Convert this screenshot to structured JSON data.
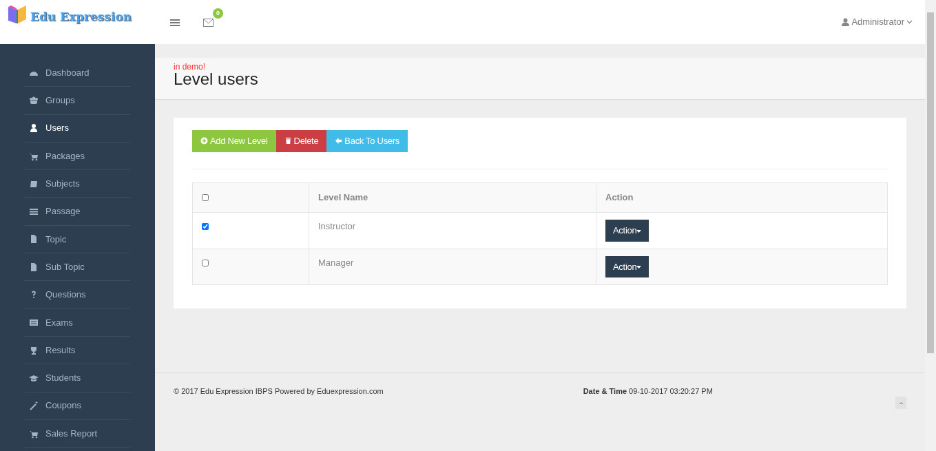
{
  "header": {
    "logo": "Edu Expression",
    "notifications": "0",
    "user": "Administrator"
  },
  "sidebar": {
    "items": [
      {
        "label": "Dashboard",
        "selected": false
      },
      {
        "label": "Groups",
        "selected": false
      },
      {
        "label": "Users",
        "selected": true
      },
      {
        "label": "Packages",
        "selected": false
      },
      {
        "label": "Subjects",
        "selected": false
      },
      {
        "label": "Passage",
        "selected": false
      },
      {
        "label": "Topic",
        "selected": false
      },
      {
        "label": "Sub Topic",
        "selected": false
      },
      {
        "label": "Questions",
        "selected": false
      },
      {
        "label": "Exams",
        "selected": false
      },
      {
        "label": "Results",
        "selected": false
      },
      {
        "label": "Students",
        "selected": false
      },
      {
        "label": "Coupons",
        "selected": false
      },
      {
        "label": "Sales Report",
        "selected": false
      }
    ]
  },
  "page": {
    "notice": "in demo!",
    "title": "Level users"
  },
  "buttons": [
    {
      "label": "Add New Level",
      "kind": "add"
    },
    {
      "label": "Delete",
      "kind": "delete"
    },
    {
      "label": "Back To Users",
      "kind": "back"
    }
  ],
  "table": {
    "columns": [
      "Level Name",
      "Action"
    ],
    "header_checked": false,
    "rows": [
      {
        "name": "Instructor",
        "checked": true,
        "action": "Action"
      },
      {
        "name": "Manager",
        "checked": false,
        "action": "Action"
      }
    ]
  },
  "footer": {
    "copyright": "© 2017 Edu Expression IBPS Powered by Eduexpression.com",
    "datetime": "**Date & Time** 09-10-2017 03:20:27 PM"
  }
}
